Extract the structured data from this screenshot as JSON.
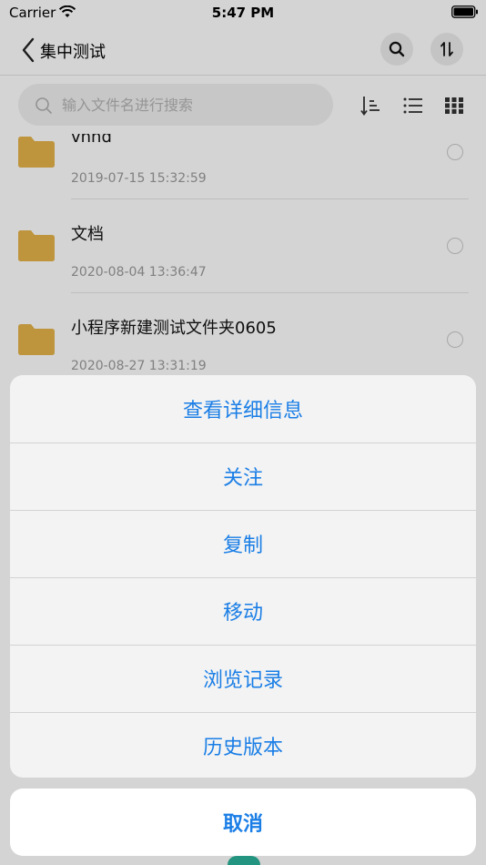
{
  "status_bar": {
    "carrier": "Carrier",
    "time": "5:47 PM"
  },
  "nav": {
    "title": "集中测试",
    "icons": [
      "back-icon",
      "search-icon",
      "sort-arrows-icon"
    ]
  },
  "search": {
    "placeholder": "输入文件名进行搜索",
    "value": "",
    "tools": [
      "sort-icon",
      "list-view-icon",
      "grid-view-icon"
    ]
  },
  "files": [
    {
      "name": "vnhd",
      "date": "2019-07-15 15:32:59"
    },
    {
      "name": "文档",
      "date": "2020-08-04 13:36:47"
    },
    {
      "name": "小程序新建测试文件夹0605",
      "date": "2020-08-27 13:31:19"
    }
  ],
  "action_sheet": {
    "items": [
      "查看详细信息",
      "关注",
      "复制",
      "移动",
      "浏览记录",
      "历史版本"
    ],
    "cancel": "取消"
  },
  "colors": {
    "accent": "#1a7ee6",
    "folder": "#e5b24a",
    "tab_active": "#2bb39a"
  }
}
